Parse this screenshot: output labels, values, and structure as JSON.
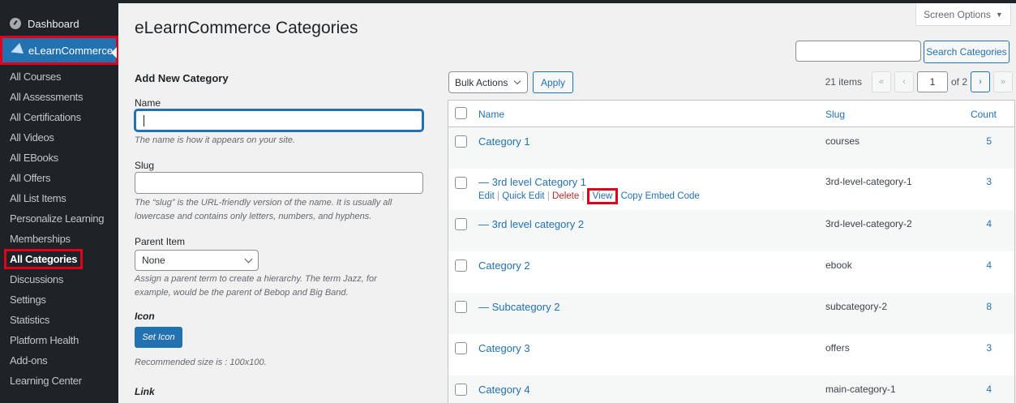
{
  "sidebar": {
    "dashboard": "Dashboard",
    "plugin": "eLearnCommerce",
    "items": [
      "All Courses",
      "All Assessments",
      "All Certifications",
      "All Videos",
      "All EBooks",
      "All Offers",
      "All List Items",
      "Personalize Learning",
      "Memberships",
      "All Categories",
      "Discussions",
      "Settings",
      "Statistics",
      "Platform Health",
      "Add-ons",
      "Learning Center"
    ],
    "current_index": 9
  },
  "header": {
    "title": "eLearnCommerce Categories",
    "screen_options": "Screen Options",
    "search_button": "Search Categories",
    "search_value": ""
  },
  "form": {
    "heading": "Add New Category",
    "name_label": "Name",
    "name_value": "",
    "name_desc": "The name is how it appears on your site.",
    "slug_label": "Slug",
    "slug_value": "",
    "slug_desc_1": "The “slug” is the URL-friendly version of the name. It is usually all",
    "slug_desc_2": "lowercase and contains only letters, numbers, and hyphens.",
    "parent_label": "Parent Item",
    "parent_value": "None",
    "parent_desc_1": "Assign a parent term to create a hierarchy. The term Jazz, for",
    "parent_desc_2": "example, would be the parent of Bebop and Big Band.",
    "icon_label": "Icon",
    "set_icon": "Set Icon",
    "icon_desc": "Recommended size is : 100x100.",
    "link_label": "Link"
  },
  "toolbar": {
    "bulk_actions": "Bulk Actions",
    "apply": "Apply",
    "items_count": "21 items",
    "first": "«",
    "prev": "‹",
    "page": "1",
    "of_pages": "of 2",
    "next": "›",
    "last": "»"
  },
  "table": {
    "headers": {
      "name": "Name",
      "slug": "Slug",
      "count": "Count"
    },
    "rows": [
      {
        "name": "Category 1",
        "slug": "courses",
        "count": "5"
      },
      {
        "name": "— 3rd level Category 1",
        "slug": "3rd-level-category-1",
        "count": "3"
      },
      {
        "name": "— 3rd level category 2",
        "slug": "3rd-level-category-2",
        "count": "4"
      },
      {
        "name": "Category 2",
        "slug": "ebook",
        "count": "4"
      },
      {
        "name": "— Subcategory 2",
        "slug": "subcategory-2",
        "count": "8"
      },
      {
        "name": "Category 3",
        "slug": "offers",
        "count": "3"
      },
      {
        "name": "Category 4",
        "slug": "main-category-1",
        "count": "4"
      }
    ],
    "row_actions": {
      "edit": "Edit",
      "quick_edit": "Quick Edit",
      "delete": "Delete",
      "view": "View",
      "copy_embed": "Copy Embed Code"
    }
  },
  "colors": {
    "accent": "#2271b1",
    "sidebar_bg": "#1d2327",
    "highlight": "#e0001a"
  }
}
